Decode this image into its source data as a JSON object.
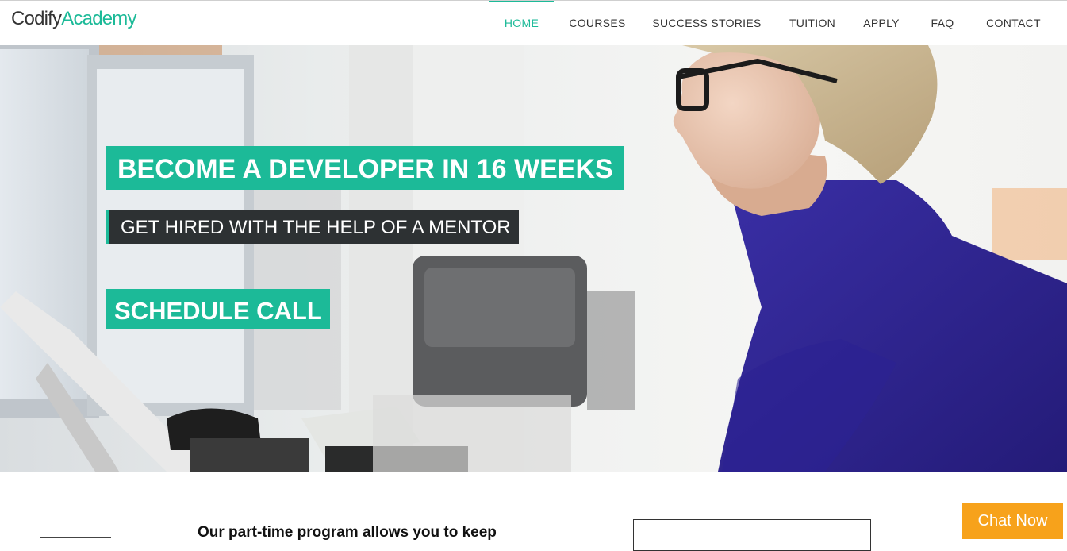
{
  "brand": {
    "name_part1": "Codify",
    "name_part2": "Academy",
    "accent_color": "#1cba98"
  },
  "nav": {
    "items": [
      {
        "label": "HOME",
        "active": true
      },
      {
        "label": "COURSES",
        "active": false
      },
      {
        "label": "SUCCESS STORIES",
        "active": false
      },
      {
        "label": "TUITION",
        "active": false
      },
      {
        "label": "APPLY",
        "active": false
      },
      {
        "label": "FAQ",
        "active": false
      },
      {
        "label": "CONTACT",
        "active": false
      }
    ]
  },
  "hero": {
    "headline": "BECOME A DEVELOPER IN 16 WEEKS",
    "subheadline": "GET HIRED WITH THE HELP OF A MENTOR",
    "cta_label": "SCHEDULE CALL",
    "cta_color": "#1cba98",
    "sub_bg_color": "#2d3133"
  },
  "intro": {
    "text": "Our part-time program allows you to keep"
  },
  "chat": {
    "label": "Chat Now",
    "color": "#f7a21b"
  }
}
